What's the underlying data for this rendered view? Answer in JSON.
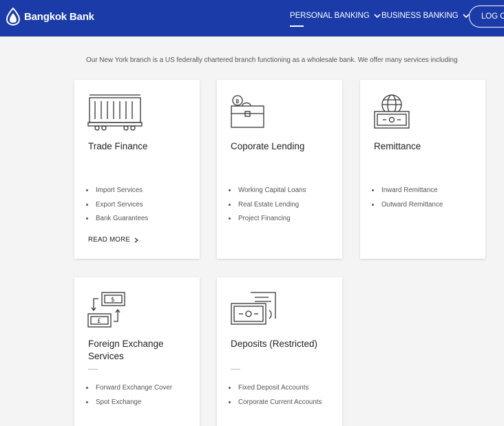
{
  "header": {
    "brand": "Bangkok Bank",
    "nav": [
      {
        "label": "PERSONAL BANKING"
      },
      {
        "label": "BUSINESS BANKING"
      }
    ],
    "login_label": "LOG ON"
  },
  "intro": "Our New York branch is a US federally chartered branch functioning as a wholesale bank. We offer many services including",
  "cards": [
    {
      "title": "Trade Finance",
      "icon": "shipping-container-icon",
      "items": [
        "Import Services",
        "Export Services",
        "Bank Guarantees"
      ],
      "read_more": "READ MORE"
    },
    {
      "title": "Coporate Lending",
      "icon": "briefcase-coin-icon",
      "items": [
        "Working Capital Loans",
        "Real Estate Lending",
        "Project Financing"
      ]
    },
    {
      "title": "Remittance",
      "icon": "globe-banknote-icon",
      "items": [
        "Inward Remittance",
        "Outward Remittance"
      ]
    },
    {
      "title": "Foreign Exchange Services",
      "icon": "currency-exchange-icon",
      "items": [
        "Forward Exchange Cover",
        "Spot Exchange"
      ]
    },
    {
      "title": "Deposits (Restricted)",
      "icon": "deposit-document-icon",
      "items": [
        "Fixed Deposit Accounts",
        "Corporate Current Accounts"
      ]
    }
  ],
  "colors": {
    "header": "#1a3ba8",
    "background": "#f4f4f4",
    "card": "#ffffff"
  }
}
